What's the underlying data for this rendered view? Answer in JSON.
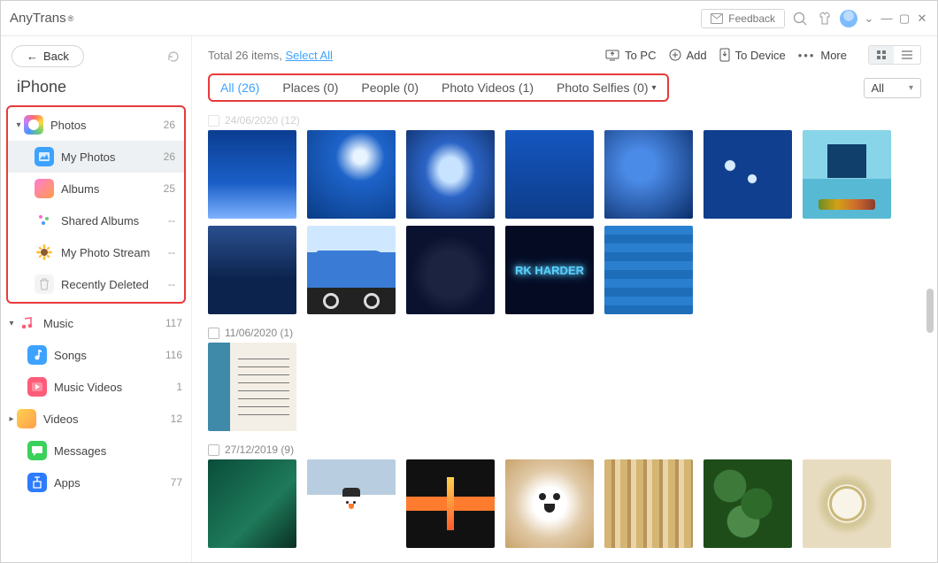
{
  "app": {
    "name": "AnyTrans",
    "reg": "®",
    "feedback": "Feedback"
  },
  "sidebar": {
    "back": "Back",
    "device": "iPhone",
    "photos": {
      "label": "Photos",
      "count": "26"
    },
    "myphotos": {
      "label": "My Photos",
      "count": "26"
    },
    "albums": {
      "label": "Albums",
      "count": "25"
    },
    "shared": {
      "label": "Shared Albums",
      "count": "--"
    },
    "stream": {
      "label": "My Photo Stream",
      "count": "--"
    },
    "deleted": {
      "label": "Recently Deleted",
      "count": "--"
    },
    "music": {
      "label": "Music",
      "count": "117"
    },
    "songs": {
      "label": "Songs",
      "count": "116"
    },
    "mv": {
      "label": "Music Videos",
      "count": "1"
    },
    "videos": {
      "label": "Videos",
      "count": "12"
    },
    "messages": {
      "label": "Messages",
      "count": ""
    },
    "apps": {
      "label": "Apps",
      "count": "77"
    }
  },
  "toolbar": {
    "total_prefix": "Total 26 items, ",
    "select_all": "Select All",
    "to_pc": "To PC",
    "add": "Add",
    "to_device": "To Device",
    "more": "More"
  },
  "filters": {
    "all": "All (26)",
    "places": "Places (0)",
    "people": "People (0)",
    "videos": "Photo Videos (1)",
    "selfies": "Photo Selfies (0)",
    "dropdown": "All"
  },
  "groups": {
    "g0": "24/06/2020 (12)",
    "g1": "11/06/2020 (1)",
    "g2": "27/12/2019 (9)"
  }
}
